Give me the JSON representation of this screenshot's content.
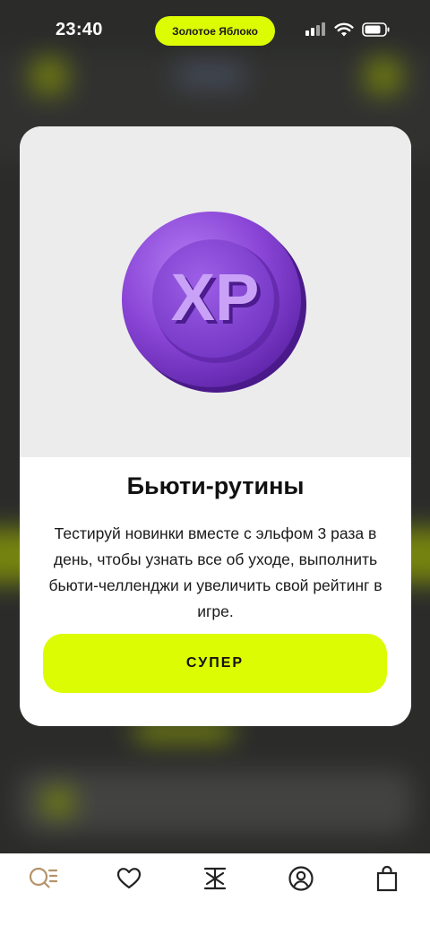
{
  "status_bar": {
    "time": "23:40",
    "pill_label": "Золотое Яблоко",
    "icons": [
      "signal-icon",
      "wifi-icon",
      "battery-icon"
    ]
  },
  "modal": {
    "illustration": {
      "icon": "xp-coin-icon",
      "coin_text": "XP",
      "coin_color": "#8a45d6"
    },
    "title": "Бьюти-рутины",
    "body": "Тестируй новинки вместе с эльфом 3 раза в день, чтобы узнать все об уходе, выполнить бьюти-челленджи и увеличить свой рейтинг в игре.",
    "cta_label": "СУПЕР"
  },
  "tab_bar": {
    "items": [
      {
        "icon": "search-catalog-icon",
        "active": true
      },
      {
        "icon": "heart-icon",
        "active": false
      },
      {
        "icon": "brand-logo-icon",
        "active": false
      },
      {
        "icon": "profile-icon",
        "active": false
      },
      {
        "icon": "shopping-bag-icon",
        "active": false
      }
    ]
  },
  "colors": {
    "accent": "#dcfc04",
    "active_tab": "#b5926a",
    "coin": "#8a45d6",
    "text": "#111111"
  }
}
